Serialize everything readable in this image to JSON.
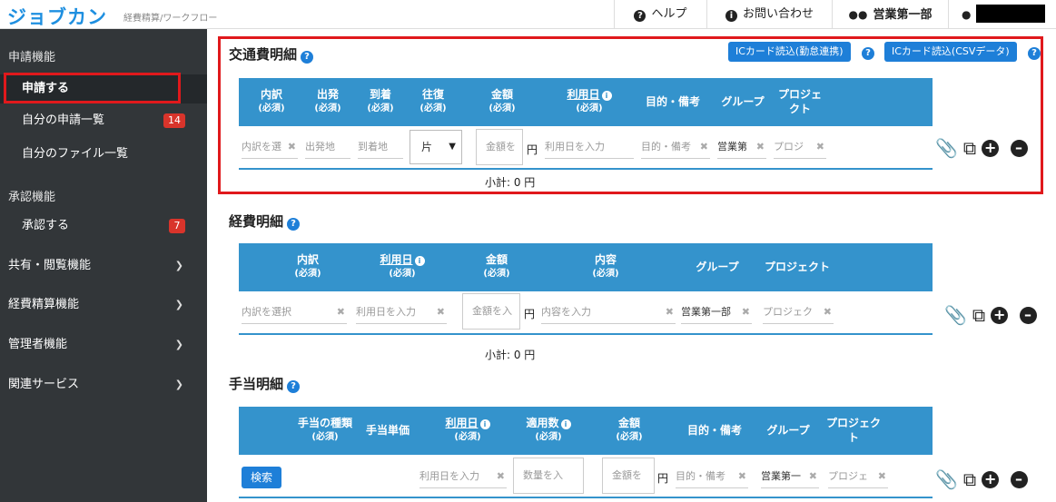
{
  "header": {
    "logo": "ジョブカン",
    "logo_sub": "経費精算/ワークフロー",
    "help": "ヘルプ",
    "contact": "お問い合わせ",
    "department": "営業第一部"
  },
  "sidebar": {
    "section_apply": "申請機能",
    "apply": "申請する",
    "my_requests": "自分の申請一覧",
    "my_requests_badge": "14",
    "my_files": "自分のファイル一覧",
    "section_approve": "承認機能",
    "approve": "承認する",
    "approve_badge": "7",
    "share": "共有・閲覧機能",
    "expense": "経費精算機能",
    "admin": "管理者機能",
    "related": "関連サービス"
  },
  "transport": {
    "title": "交通費明細",
    "btn_ic_attendance": "ICカード読込(勤怠連携)",
    "btn_ic_csv": "ICカード読込(CSVデータ)",
    "cols": {
      "item": "内訳",
      "dep": "出発",
      "arr": "到着",
      "round": "往復",
      "amount": "金額",
      "date": "利用日",
      "purpose": "目的・備考",
      "group": "グループ",
      "project_1": "プロジェ",
      "project_2": "クト",
      "required": "(必須)"
    },
    "row": {
      "item_ph": "内訳を選",
      "dep_ph": "出発地",
      "arr_ph": "到着地",
      "round_val": "片",
      "amount_ph": "金額を",
      "yen": "円",
      "date_ph": "利用日を入力",
      "purpose_ph": "目的・備考",
      "group_val": "営業第",
      "project_ph": "プロジ"
    },
    "subtotal": "小計: 0 円"
  },
  "expense": {
    "title": "経費明細",
    "cols": {
      "item": "内訳",
      "date": "利用日",
      "amount": "金額",
      "content": "内容",
      "group": "グループ",
      "project": "プロジェクト",
      "required": "(必須)"
    },
    "row": {
      "item_ph": "内訳を選択",
      "date_ph": "利用日を入力",
      "amount_ph": "金額を入",
      "yen": "円",
      "content_ph": "内容を入力",
      "group_val": "営業第一部",
      "project_ph": "プロジェク"
    },
    "subtotal": "小計: 0 円"
  },
  "allowance": {
    "title": "手当明細",
    "cols": {
      "type": "手当の種類",
      "unit": "手当単価",
      "date": "利用日",
      "count": "適用数",
      "amount": "金額",
      "purpose": "目的・備考",
      "group": "グループ",
      "project_1": "プロジェク",
      "project_2": "ト",
      "required": "(必須)"
    },
    "row": {
      "search_btn": "検索",
      "date_ph": "利用日を入力",
      "count_ph": "数量を入",
      "amount_ph": "金額を",
      "yen": "円",
      "purpose_ph": "目的・備考",
      "group_val": "営業第一",
      "project_ph": "プロジェ"
    }
  },
  "icons": {
    "help": "question-circle-icon",
    "info": "info-circle-icon",
    "users": "users-icon",
    "user": "user-icon",
    "attach": "paperclip-icon",
    "copy": "copy-icon",
    "add": "plus-circle-icon",
    "remove": "minus-circle-icon",
    "clear": "x-icon",
    "chevron": "chevron-down-icon"
  },
  "colors": {
    "brand": "#1e8fe0",
    "table_header": "#3493cc",
    "sidebar_bg": "#323639",
    "badge": "#d9342b",
    "highlight": "#e0191c"
  }
}
